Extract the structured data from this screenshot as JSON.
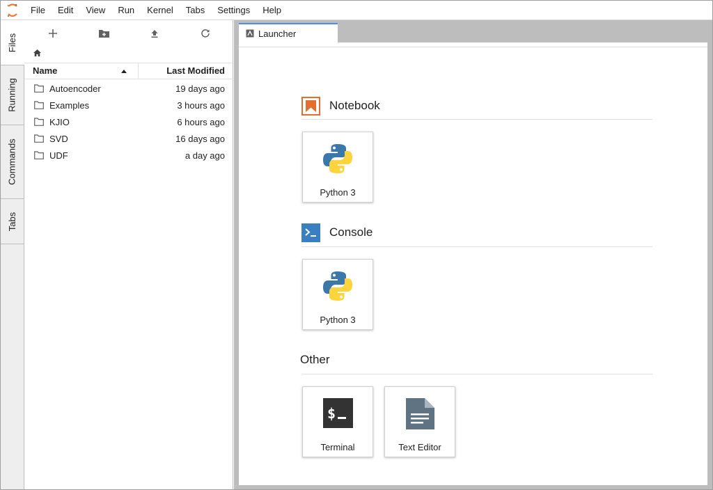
{
  "menu": [
    "File",
    "Edit",
    "View",
    "Run",
    "Kernel",
    "Tabs",
    "Settings",
    "Help"
  ],
  "left_tabs": [
    "Files",
    "Running",
    "Commands",
    "Tabs"
  ],
  "filebrowser": {
    "columns": {
      "name": "Name",
      "modified": "Last Modified"
    },
    "items": [
      {
        "name": "Autoencoder",
        "modified": "19 days ago"
      },
      {
        "name": "Examples",
        "modified": "3 hours ago"
      },
      {
        "name": "KJIO",
        "modified": "6 hours ago"
      },
      {
        "name": "SVD",
        "modified": "16 days ago"
      },
      {
        "name": "UDF",
        "modified": "a day ago"
      }
    ]
  },
  "main_tab": {
    "label": "Launcher"
  },
  "launcher": {
    "notebook": {
      "title": "Notebook",
      "cards": [
        "Python 3"
      ]
    },
    "console": {
      "title": "Console",
      "cards": [
        "Python 3"
      ]
    },
    "other": {
      "title": "Other",
      "cards": [
        "Terminal",
        "Text Editor"
      ]
    }
  },
  "colors": {
    "accent_blue": "#4a90e2",
    "notebook_orange": "#e46e2e",
    "console_blue": "#3a7fc1",
    "logo_orange": "#f37626"
  },
  "icons": {
    "app": "jupyter-logo-icon",
    "new_launcher": "plus-icon",
    "new_folder": "new-folder-icon",
    "upload": "upload-icon",
    "refresh": "refresh-icon",
    "home": "home-icon",
    "folder": "folder-icon",
    "python": "python-logo-icon",
    "terminal": "terminal-icon",
    "text_editor": "text-file-icon"
  }
}
